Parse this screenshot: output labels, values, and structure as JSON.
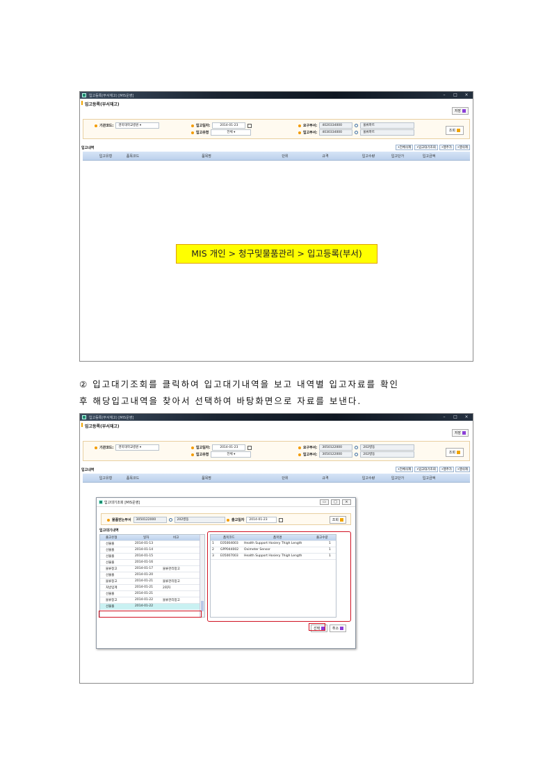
{
  "window": {
    "title": "입고등록(부서재고) [MIS운영]",
    "form_title": "입고등록(부서재고)",
    "save_label": "저장",
    "inquire_label": "조회"
  },
  "filters1": {
    "org_label": "기관코드:",
    "org_value": "경북대학교병원",
    "in_date_label": "입고일자:",
    "in_date_value": "2014-01-23",
    "in_type_label": "입고유형",
    "in_type_value": "전체",
    "req_dept_label": "요구부서:",
    "req_dept_code": "4020334000",
    "req_dept_name": "물류파트",
    "in_dept_label": "입고부서:",
    "in_dept_code": "4030334000",
    "in_dept_name": "물류파트"
  },
  "filters2": {
    "req_dept_code": "3050122000",
    "req_dept_name": "202병동",
    "in_dept_code": "3050122000",
    "in_dept_name": "202병동"
  },
  "section": {
    "title": "입고내역",
    "buttons": [
      "•전체삭제",
      "•입고대기조회",
      "•행추가",
      "•행삭제"
    ]
  },
  "grid_columns": [
    "입고유형",
    "품목코드",
    "품목명",
    "단위",
    "규격",
    "입고수량",
    "입고단가",
    "입고금액"
  ],
  "nav_text": "MIS 개인 > 청구및물품관리 > 입고등록(부서)",
  "caption": {
    "line1": "② 입고대기조회를 클릭하여 입고대기내역을 보고 내역별 입고자료를 확인",
    "line2": "후 해당입고내역을 찾아서 선택하여 바탕화면으로 자료를 보낸다."
  },
  "dialog": {
    "title": "입고대기조회 [MIS운영]",
    "dept_label": "물품받는부서",
    "dept_code": "3050122000",
    "dept_name": "202병동",
    "date_label": "출고일자",
    "date_value": "2014-01-23",
    "inquire_label": "조회",
    "list_title": "입고대기내역",
    "left_columns": [
      "출고유형",
      "일자",
      "비고"
    ],
    "left_rows": [
      [
        "선불출",
        "2014-01-13",
        ""
      ],
      [
        "선불출",
        "2014-01-14",
        ""
      ],
      [
        "선불출",
        "2014-01-15",
        ""
      ],
      [
        "선불출",
        "2014-01-16",
        ""
      ],
      [
        "물류창고",
        "2014-01-17",
        "물류관리창고"
      ],
      [
        "선불출",
        "2014-01-20",
        ""
      ],
      [
        "물류창고",
        "2014-01-21",
        "물류관리창고"
      ],
      [
        "처방입계",
        "2014-01-21",
        "2회차"
      ],
      [
        "선불출",
        "2014-01-21",
        ""
      ],
      [
        "물류창고",
        "2014-01-22",
        "물류관리창고"
      ],
      [
        "선불출",
        "2014-01-22",
        ""
      ]
    ],
    "right_columns": [
      "품목코드",
      "품목명",
      "출고수량"
    ],
    "right_rows": [
      [
        "1",
        "E05004003",
        "Health Support Hosiery Thigh Length",
        "1"
      ],
      [
        "2",
        "GPP044002",
        "Oximeter Sensor",
        "1"
      ],
      [
        "3",
        "E05007003",
        "Health Support Hosiery Thigh Length",
        "1"
      ]
    ],
    "select_label": "선택",
    "cancel_label": "취소"
  }
}
